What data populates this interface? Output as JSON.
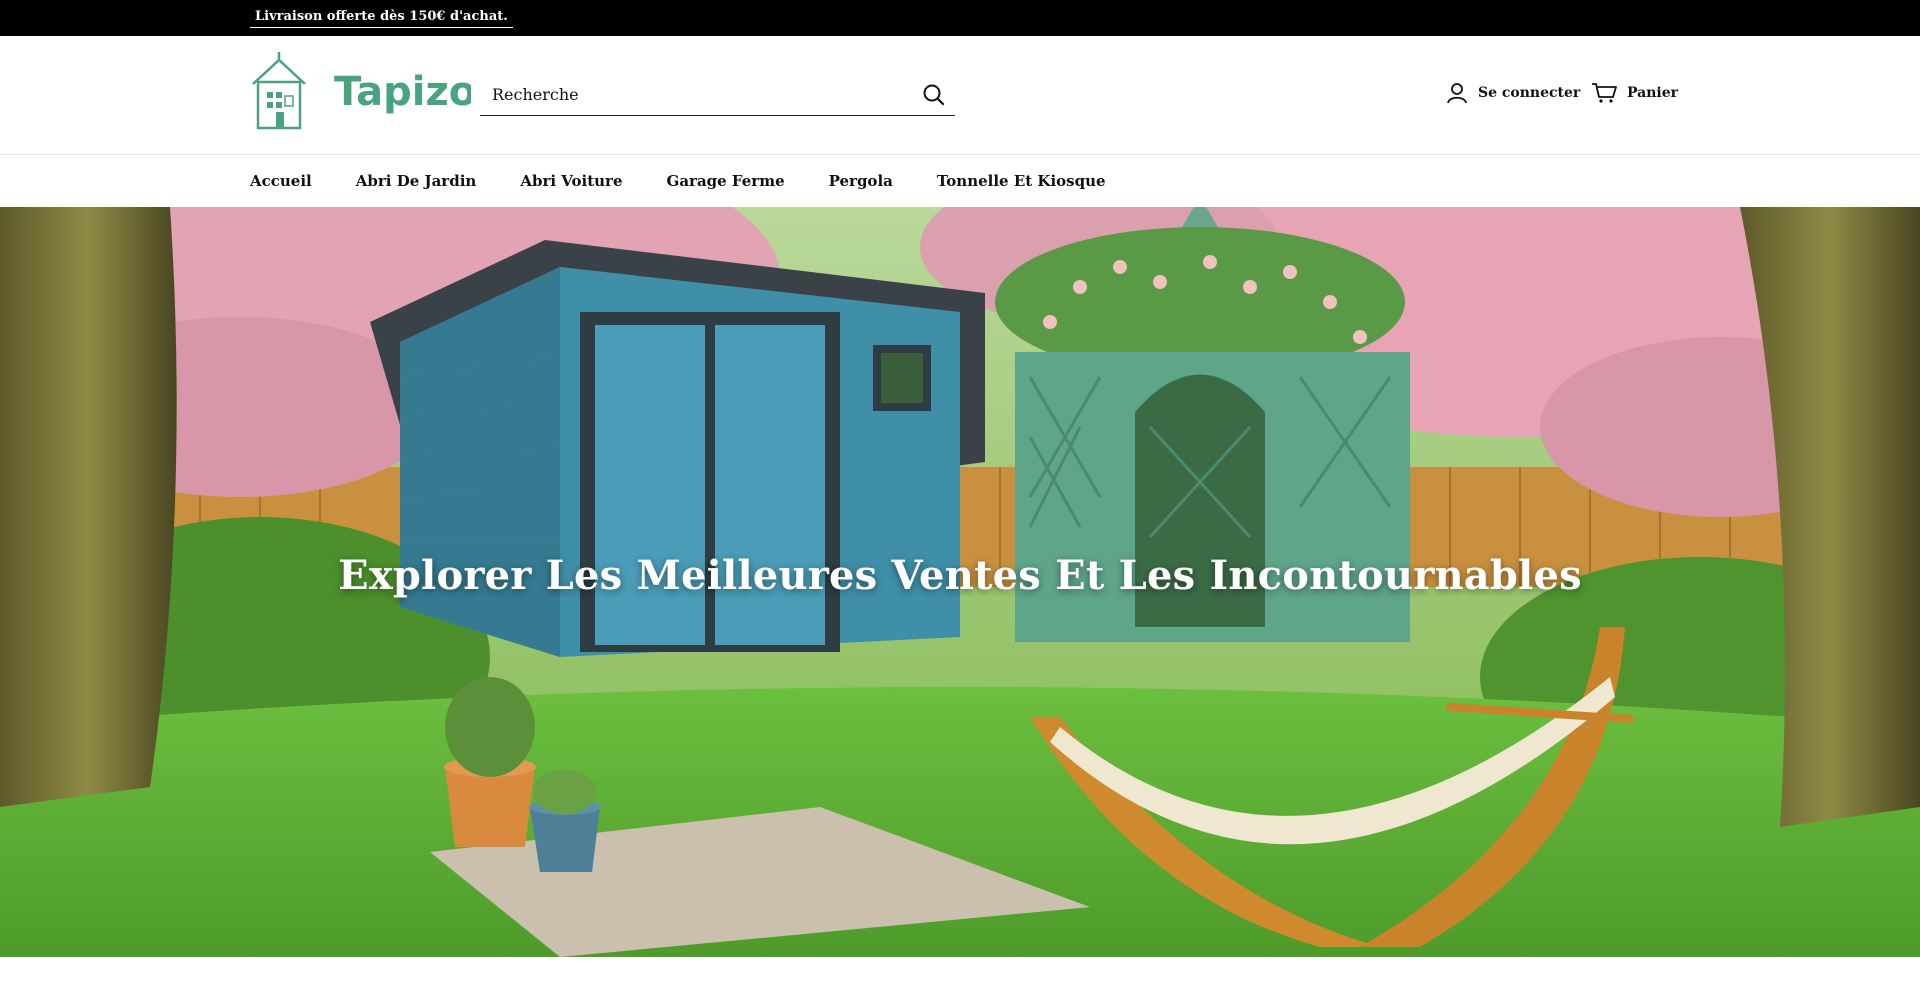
{
  "announcement": {
    "text": "Livraison offerte dès 150€ d'achat."
  },
  "header": {
    "logo_text": "Tapizor",
    "search": {
      "placeholder": "Recherche"
    },
    "account_label": "Se connecter",
    "cart_label": "Panier"
  },
  "nav": {
    "items": [
      {
        "label": "Accueil"
      },
      {
        "label": "Abri De Jardin"
      },
      {
        "label": "Abri Voiture"
      },
      {
        "label": "Garage Ferme"
      },
      {
        "label": "Pergola"
      },
      {
        "label": "Tonnelle Et Kiosque"
      }
    ]
  },
  "hero": {
    "title": "Explorer Les Meilleures Ventes Et Les Incontournables"
  },
  "colors": {
    "brand": "#4aa37f",
    "announcement_bg": "#000000",
    "shed_blue": "#3f8fa8",
    "kiosk_green": "#5ea58a",
    "blossom": "#e6a4b4",
    "grass": "#6cbf3f"
  },
  "icons": {
    "search": "search-icon",
    "account": "user-icon",
    "cart": "cart-icon"
  }
}
